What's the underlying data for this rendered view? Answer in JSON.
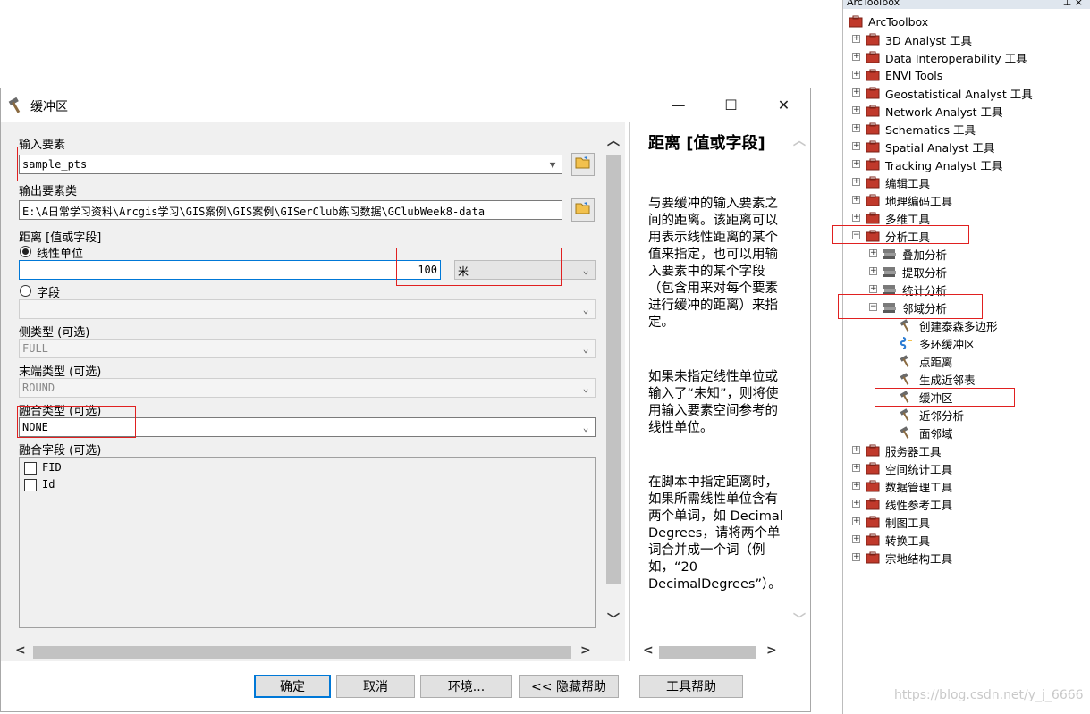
{
  "dialog": {
    "title": "缓冲区",
    "controls": {
      "minimize": "—",
      "maximize": "☐",
      "close": "✕"
    },
    "fields": {
      "input_label": "输入要素",
      "input_value": "sample_pts",
      "output_label": "输出要素类",
      "output_value": "E:\\A日常学习资料\\Arcgis学习\\GIS案例\\GIS案例\\GISerClub练习数据\\GClubWeek8-data",
      "distance_label": "距离 [值或字段]",
      "linear_unit_label": "线性单位",
      "distance_value": "100",
      "unit_value": "米",
      "field_radio_label": "字段",
      "side_type_label": "侧类型 (可选)",
      "side_type_value": "FULL",
      "end_type_label": "末端类型 (可选)",
      "end_type_value": "ROUND",
      "dissolve_type_label": "融合类型 (可选)",
      "dissolve_type_value": "NONE",
      "dissolve_field_label": "融合字段 (可选)",
      "dissolve_fields": [
        "FID",
        "Id"
      ]
    },
    "buttons": {
      "ok": "确定",
      "cancel": "取消",
      "env": "环境...",
      "hide_help": "<< 隐藏帮助",
      "tool_help": "工具帮助"
    },
    "help": {
      "title": "距离 [值或字段]",
      "p1": "与要缓冲的输入要素之间的距离。该距离可以用表示线性距离的某个值来指定，也可以用输入要素中的某个字段（包含用来对每个要素进行缓冲的距离）来指定。",
      "p2": "如果未指定线性单位或输入了“未知”，则将使用输入要素空间参考的线性单位。",
      "p3": "在脚本中指定距离时，如果所需线性单位含有两个单词，如 Decimal Degrees，请将两个单词合并成一个词（例如，“20 DecimalDegrees”）。"
    }
  },
  "toolbox": {
    "header": "ArcToolbox",
    "root": "ArcToolbox",
    "items": [
      {
        "label": "3D Analyst 工具",
        "level": 0,
        "expander": "+",
        "icon": "toolbox-icon"
      },
      {
        "label": "Data Interoperability 工具",
        "level": 0,
        "expander": "+",
        "icon": "toolbox-icon"
      },
      {
        "label": "ENVI Tools",
        "level": 0,
        "expander": "+",
        "icon": "toolbox-icon"
      },
      {
        "label": "Geostatistical Analyst 工具",
        "level": 0,
        "expander": "+",
        "icon": "toolbox-icon"
      },
      {
        "label": "Network Analyst 工具",
        "level": 0,
        "expander": "+",
        "icon": "toolbox-icon"
      },
      {
        "label": "Schematics 工具",
        "level": 0,
        "expander": "+",
        "icon": "toolbox-icon"
      },
      {
        "label": "Spatial Analyst 工具",
        "level": 0,
        "expander": "+",
        "icon": "toolbox-icon"
      },
      {
        "label": "Tracking Analyst 工具",
        "level": 0,
        "expander": "+",
        "icon": "toolbox-icon"
      },
      {
        "label": "编辑工具",
        "level": 0,
        "expander": "+",
        "icon": "toolbox-icon"
      },
      {
        "label": "地理编码工具",
        "level": 0,
        "expander": "+",
        "icon": "toolbox-icon"
      },
      {
        "label": "多维工具",
        "level": 0,
        "expander": "+",
        "icon": "toolbox-icon"
      },
      {
        "label": "分析工具",
        "level": 0,
        "expander": "−",
        "icon": "toolbox-icon"
      },
      {
        "label": "叠加分析",
        "level": 1,
        "expander": "+",
        "icon": "toolset-icon"
      },
      {
        "label": "提取分析",
        "level": 1,
        "expander": "+",
        "icon": "toolset-icon"
      },
      {
        "label": "统计分析",
        "level": 1,
        "expander": "+",
        "icon": "toolset-icon"
      },
      {
        "label": "邻域分析",
        "level": 1,
        "expander": "−",
        "icon": "toolset-icon"
      },
      {
        "label": "创建泰森多边形",
        "level": 2,
        "expander": "",
        "icon": "hammer-icon"
      },
      {
        "label": "多环缓冲区",
        "level": 2,
        "expander": "",
        "icon": "script-icon"
      },
      {
        "label": "点距离",
        "level": 2,
        "expander": "",
        "icon": "hammer-icon"
      },
      {
        "label": "生成近邻表",
        "level": 2,
        "expander": "",
        "icon": "hammer-icon"
      },
      {
        "label": "缓冲区",
        "level": 2,
        "expander": "",
        "icon": "hammer-icon"
      },
      {
        "label": "近邻分析",
        "level": 2,
        "expander": "",
        "icon": "hammer-icon"
      },
      {
        "label": "面邻域",
        "level": 2,
        "expander": "",
        "icon": "hammer-icon"
      },
      {
        "label": "服务器工具",
        "level": 0,
        "expander": "+",
        "icon": "toolbox-icon"
      },
      {
        "label": "空间统计工具",
        "level": 0,
        "expander": "+",
        "icon": "toolbox-icon"
      },
      {
        "label": "数据管理工具",
        "level": 0,
        "expander": "+",
        "icon": "toolbox-icon"
      },
      {
        "label": "线性参考工具",
        "level": 0,
        "expander": "+",
        "icon": "toolbox-icon"
      },
      {
        "label": "制图工具",
        "level": 0,
        "expander": "+",
        "icon": "toolbox-icon"
      },
      {
        "label": "转换工具",
        "level": 0,
        "expander": "+",
        "icon": "toolbox-icon"
      },
      {
        "label": "宗地结构工具",
        "level": 0,
        "expander": "+",
        "icon": "toolbox-icon"
      }
    ]
  },
  "watermark": "https://blog.csdn.net/y_j_6666",
  "colors": {
    "annotation_red": "#e02020",
    "focus_blue": "#0078d7"
  }
}
